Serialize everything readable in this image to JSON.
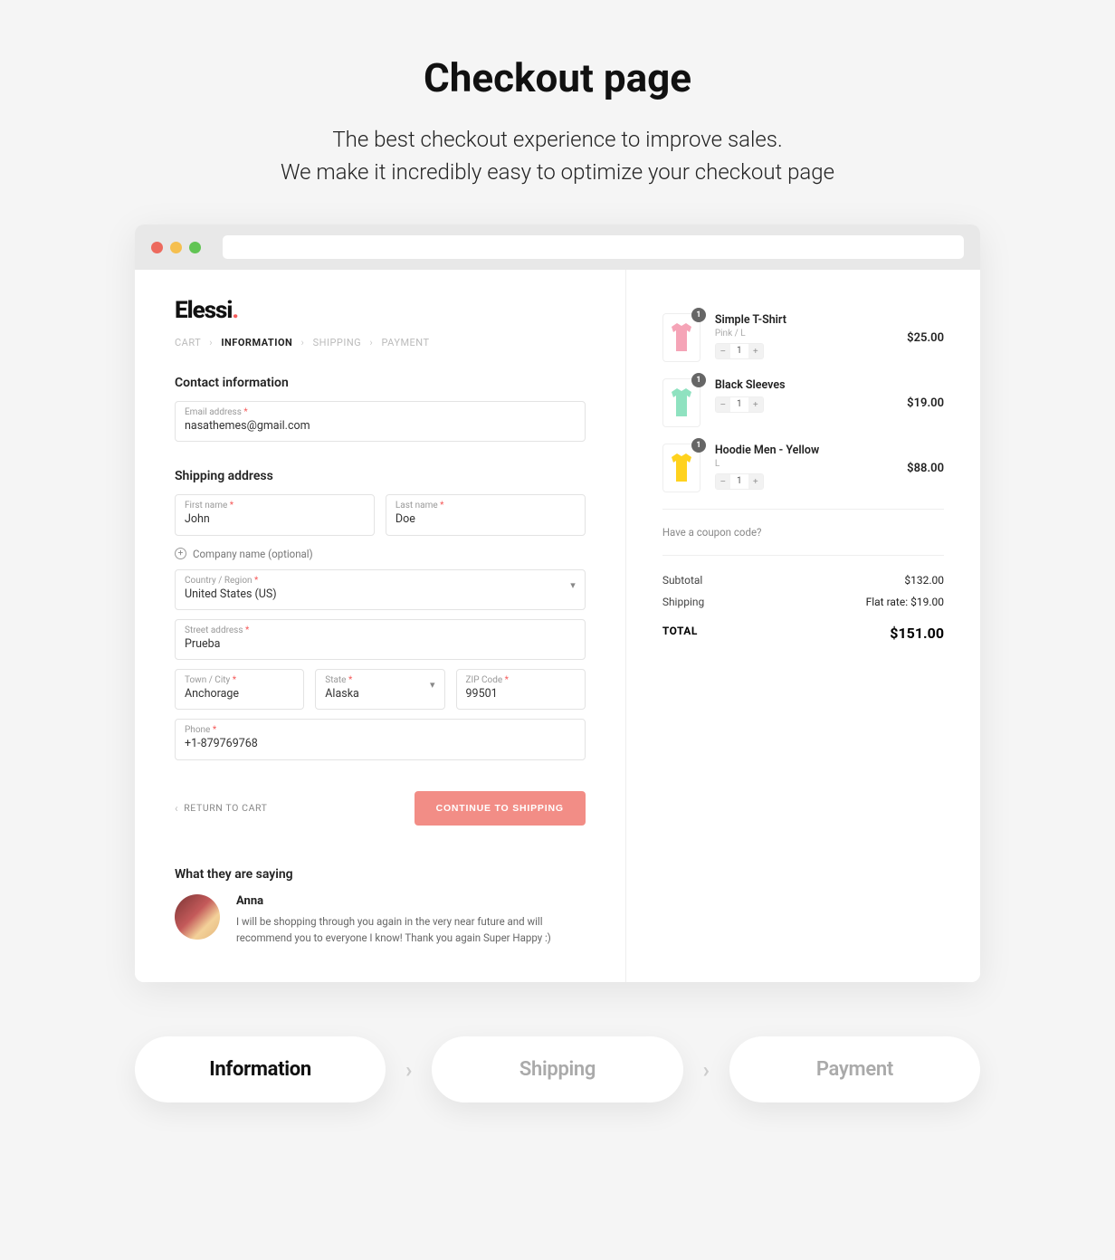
{
  "hero": {
    "title": "Checkout page",
    "line1": "The best checkout experience to improve sales.",
    "line2": "We make it incredibly easy to optimize your checkout page"
  },
  "logo": {
    "text": "Elessi",
    "accent": "."
  },
  "breadcrumbs": {
    "cart": "CART",
    "information": "INFORMATION",
    "shipping": "SHIPPING",
    "payment": "PAYMENT"
  },
  "contact": {
    "heading": "Contact information",
    "email_label": "Email address",
    "email_value": "nasathemes@gmail.com"
  },
  "shipping": {
    "heading": "Shipping address",
    "first_name_label": "First name",
    "first_name_value": "John",
    "last_name_label": "Last name",
    "last_name_value": "Doe",
    "company_toggle": "Company name (optional)",
    "country_label": "Country / Region",
    "country_value": "United States (US)",
    "street_label": "Street address",
    "street_value": "Prueba",
    "city_label": "Town / City",
    "city_value": "Anchorage",
    "state_label": "State",
    "state_value": "Alaska",
    "zip_label": "ZIP Code",
    "zip_value": "99501",
    "phone_label": "Phone",
    "phone_value": "+1-879769768"
  },
  "actions": {
    "return": "RETURN TO CART",
    "continue": "CONTINUE TO SHIPPING"
  },
  "testimonial": {
    "heading": "What they are saying",
    "name": "Anna",
    "quote": "I will be shopping through you again in the very near future and will recommend you to everyone I know! Thank you again Super Happy :)"
  },
  "cart": {
    "items": [
      {
        "name": "Simple T-Shirt",
        "variant": "Pink /  L",
        "qty": "1",
        "badge": "1",
        "price": "$25.00",
        "color": "#f5a4b7"
      },
      {
        "name": "Black Sleeves",
        "variant": "",
        "qty": "1",
        "badge": "1",
        "price": "$19.00",
        "color": "#8fe2c0"
      },
      {
        "name": "Hoodie Men - Yellow",
        "variant": "L",
        "qty": "1",
        "badge": "1",
        "price": "$88.00",
        "color": "#ffd21e"
      }
    ],
    "coupon": "Have a coupon code?",
    "subtotal_label": "Subtotal",
    "subtotal_value": "$132.00",
    "shipping_label": "Shipping",
    "shipping_value": "Flat rate: $19.00",
    "total_label": "TOTAL",
    "total_value": "$151.00"
  },
  "steps": {
    "information": "Information",
    "shipping": "Shipping",
    "payment": "Payment"
  },
  "asterisk": "*",
  "chevron": "›"
}
